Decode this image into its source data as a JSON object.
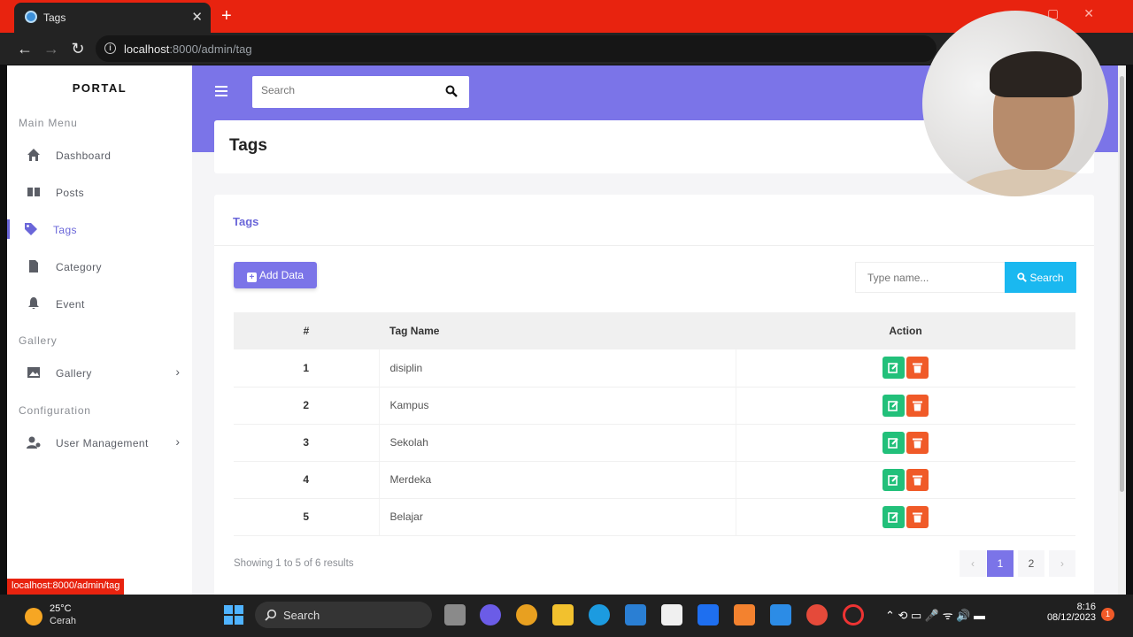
{
  "browser": {
    "tab_title": "Tags",
    "tab_close": "✕",
    "new_tab": "+",
    "url_host": "localhost",
    "url_rest": ":8000/admin/tag",
    "status_url": "localhost:8000/admin/tag"
  },
  "sidebar": {
    "brand": "PORTAL",
    "section_main": "Main Menu",
    "section_gallery": "Gallery",
    "section_config": "Configuration",
    "items": [
      {
        "label": "Dashboard"
      },
      {
        "label": "Posts"
      },
      {
        "label": "Tags"
      },
      {
        "label": "Category"
      },
      {
        "label": "Event"
      },
      {
        "label": "Gallery"
      },
      {
        "label": "User Management"
      }
    ],
    "active_item": "Tags"
  },
  "topbar": {
    "search_placeholder": "Search"
  },
  "page": {
    "title": "Tags",
    "card_title": "Tags",
    "add_button": "Add Data",
    "name_placeholder": "Type name...",
    "search_button": "Search"
  },
  "table": {
    "headers": [
      "#",
      "Tag Name",
      "Action"
    ],
    "rows": [
      {
        "num": "1",
        "name": "disiplin"
      },
      {
        "num": "2",
        "name": "Kampus"
      },
      {
        "num": "3",
        "name": "Sekolah"
      },
      {
        "num": "4",
        "name": "Merdeka"
      },
      {
        "num": "5",
        "name": "Belajar"
      }
    ]
  },
  "pagination": {
    "summary": "Showing 1 to 5 of 6 results",
    "prev": "‹",
    "pages": [
      "1",
      "2"
    ],
    "current": "1",
    "next": "›"
  },
  "taskbar": {
    "temp": "25°C",
    "weather": "Cerah",
    "search": "Search",
    "time": "8:16",
    "date": "08/12/2023",
    "notifications": "1"
  },
  "colors": {
    "accent": "#7b74e8",
    "search_button": "#1ab8f0",
    "edit": "#22c07a",
    "delete": "#f05a28",
    "browser_frame": "#e8230f"
  }
}
